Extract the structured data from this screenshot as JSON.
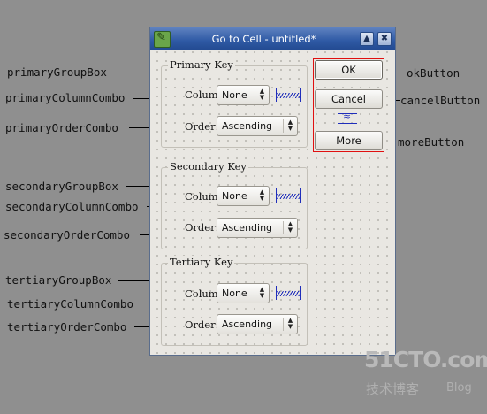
{
  "window": {
    "title": "Go to Cell - untitled*",
    "minimize_symbol": "▲",
    "close_symbol": "✖"
  },
  "groups": [
    {
      "title": "Primary Key",
      "column_label": "Column:",
      "column_value": "None",
      "order_label": "Order:",
      "order_value": "Ascending"
    },
    {
      "title": "Secondary Key",
      "column_label": "Column:",
      "column_value": "None",
      "order_label": "Order:",
      "order_value": "Ascending"
    },
    {
      "title": "Tertiary Key",
      "column_label": "Column:",
      "column_value": "None",
      "order_label": "Order:",
      "order_value": "Ascending"
    }
  ],
  "buttons": {
    "ok": "OK",
    "cancel": "Cancel",
    "more": "More"
  },
  "annotations": {
    "primaryGroupBox": "primaryGroupBox",
    "primaryColumnCombo": "primaryColumnCombo",
    "primaryOrderCombo": "primaryOrderCombo",
    "secondaryGroupBox": "secondaryGroupBox",
    "secondaryColumnCombo": "secondaryColumnCombo",
    "secondaryOrderCombo": "secondaryOrderCombo",
    "tertiaryGroupBox": "tertiaryGroupBox",
    "tertiaryColumnCombo": "tertiaryColumnCombo",
    "tertiaryOrderCombo": "tertiaryOrderCombo",
    "okButton": "okButton",
    "cancelButton": "cancelButton",
    "moreButton": "moreButton"
  },
  "watermark": {
    "main": "51CTO.com",
    "sub": "技术博客",
    "blog": "Blog"
  },
  "colors": {
    "annotation_frame": "#e01010",
    "titlebar": "#2f5aa5",
    "icon_blue": "#1f2dbb"
  }
}
